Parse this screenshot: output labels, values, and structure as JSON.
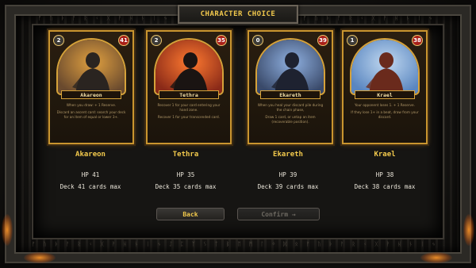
{
  "screen": {
    "title": "CHARACTER CHOICE"
  },
  "characters": [
    {
      "name": "Akareon",
      "cost": "2",
      "hp_badge": "41",
      "ability": [
        "When you draw: + 1 Reserve.",
        "Discard an ascent card: search your deck for an item of equal or lower 3+."
      ],
      "hp_text": "HP 41",
      "deck_text": "Deck 41 cards max",
      "art_colors": {
        "sky": "#6a4a2e",
        "glow": "#e0a040",
        "figure": "#2a2420"
      }
    },
    {
      "name": "Tethra",
      "cost": "2",
      "hp_badge": "35",
      "ability": [
        "Recover 1 for your card entering your hand zone.",
        "Recover 1 for your transcended card."
      ],
      "hp_text": "HP 35",
      "deck_text": "Deck 35 cards max",
      "art_colors": {
        "sky": "#8a2a18",
        "glow": "#ff7a30",
        "figure": "#1a1412"
      }
    },
    {
      "name": "Ekareth",
      "cost": "0",
      "hp_badge": "39",
      "ability": [
        "When you heal your discard pile during the chain phase,",
        "Draw 1 card, or untap an item (recoverable position)."
      ],
      "hp_text": "HP 39",
      "deck_text": "Deck 39 cards max",
      "art_colors": {
        "sky": "#3a4a6a",
        "glow": "#8fb0e0",
        "figure": "#1e2230"
      }
    },
    {
      "name": "Krael",
      "cost": "1",
      "hp_badge": "38",
      "ability": [
        "Your opponent loses 1. + 1 Reserve.",
        "If they lose 1+ in a beat, draw from your discard."
      ],
      "hp_text": "HP 38",
      "deck_text": "Deck 38 cards max",
      "art_colors": {
        "sky": "#5a86c0",
        "glow": "#c0d8f0",
        "figure": "#6a2a1c"
      }
    }
  ],
  "buttons": {
    "back": "Back",
    "confirm": "Confirm →"
  },
  "runes": "ᚠ ᚢ ᚦ ᚨ ᚱ ᚲ ᚷ ᚹ ᚺ ᚾ ᛁ ᛃ ᛇ ᛈ ᛉ ᛊ ᛏ ᛒ ᛖ ᛗ ᛚ ᛜ ᛞ ᛟ ᚠ ᚢ ᚦ ᚨ ᚱ ᚲ ᚷ ᚹ ᚺ ᚾ ᛁ ᛃ ᛇ ᛈ ᛉ ᛊ"
}
